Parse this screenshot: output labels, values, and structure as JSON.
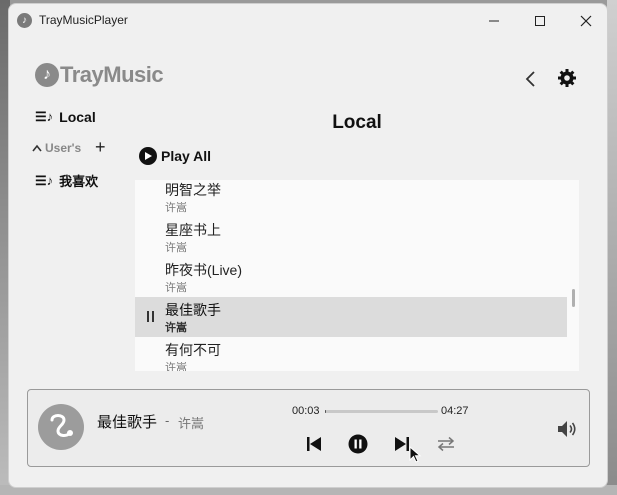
{
  "window": {
    "title": "TrayMusicPlayer",
    "app_icon": "music-note-icon"
  },
  "logo": {
    "text": "TrayMusic"
  },
  "sidebar": {
    "local_label": "Local",
    "users_label": "User's",
    "favorites_label": "我喜欢"
  },
  "page": {
    "title": "Local",
    "play_all_label": "Play All"
  },
  "songs": [
    {
      "title": "明智之举",
      "artist": "许嵩"
    },
    {
      "title": "星座书上",
      "artist": "许嵩"
    },
    {
      "title": "昨夜书(Live)",
      "artist": "许嵩"
    },
    {
      "title": "最佳歌手",
      "artist": "许嵩",
      "playing": true
    },
    {
      "title": "有何不可",
      "artist": "许嵩"
    }
  ],
  "player": {
    "title": "最佳歌手",
    "separator": "-",
    "artist": "许嵩",
    "current_time": "00:03",
    "duration": "04:27",
    "progress_fraction": 0.011
  },
  "colors": {
    "accent": "#111111",
    "active_row": "#dcdcdc",
    "logo": "#8a8a8a"
  }
}
